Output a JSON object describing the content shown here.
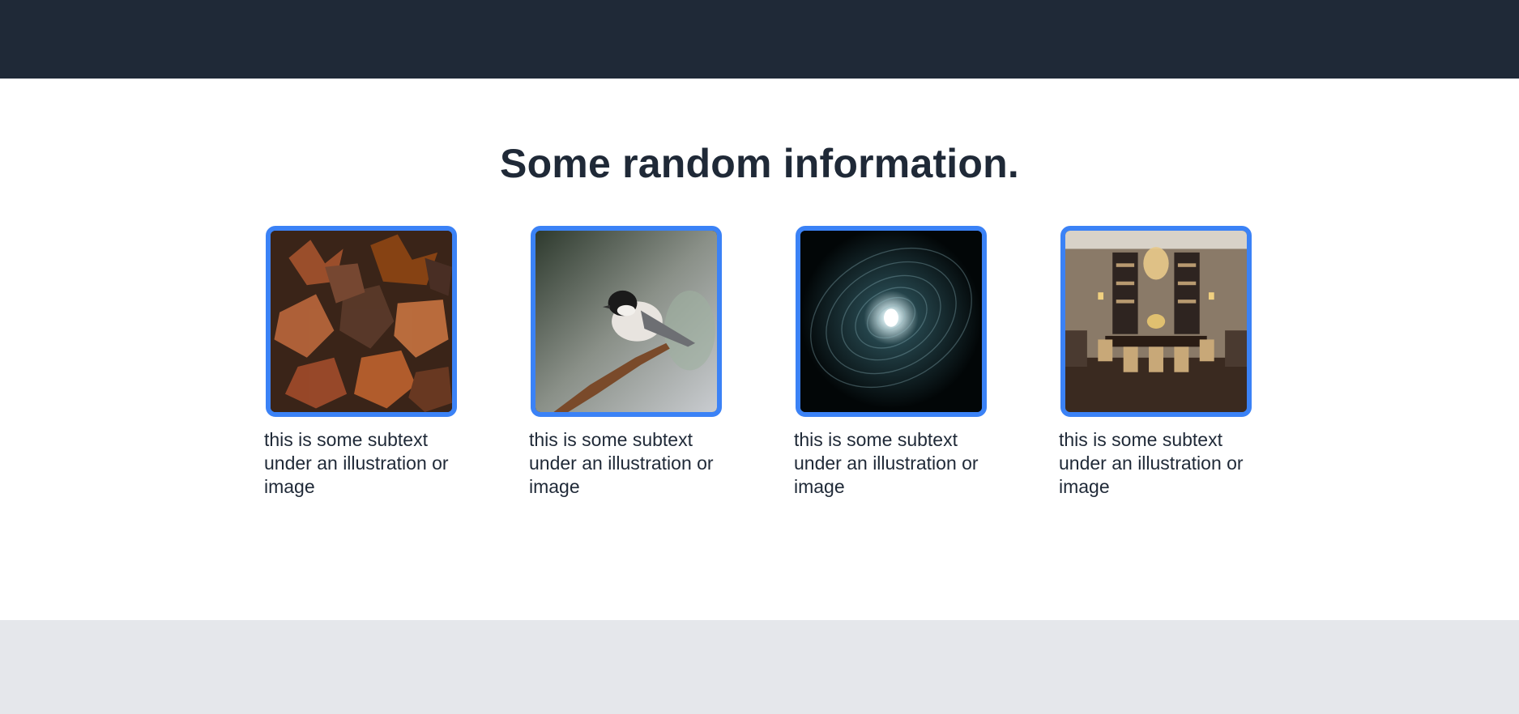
{
  "page": {
    "heading": "Some random information."
  },
  "cards": [
    {
      "image_icon": "autumn-leaves-image",
      "caption": "this is some subtext under an illustration or image"
    },
    {
      "image_icon": "bird-on-branch-image",
      "caption": "this is some subtext under an illustration or image"
    },
    {
      "image_icon": "light-spiral-image",
      "caption": "this is some subtext under an illustration or image"
    },
    {
      "image_icon": "dining-room-image",
      "caption": "this is some subtext under an illustration or image"
    }
  ],
  "colors": {
    "header_bg": "#1f2937",
    "footer_bg": "#e5e7eb",
    "accent_border": "#3b82f6",
    "text": "#1f2937"
  }
}
